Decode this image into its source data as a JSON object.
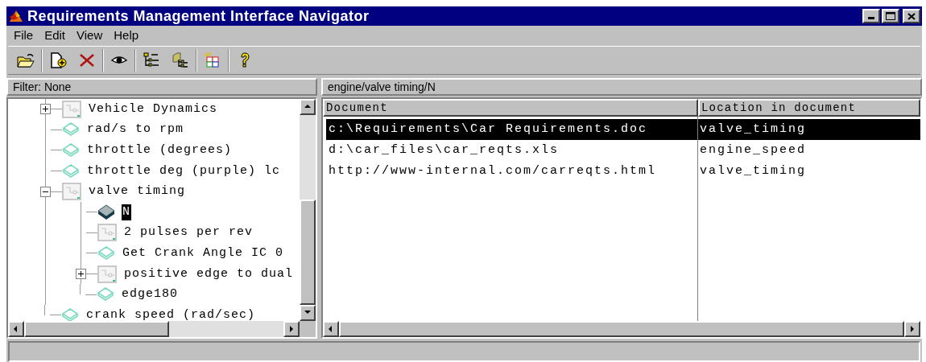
{
  "window": {
    "title": "Requirements Management Interface Navigator"
  },
  "menu": [
    "File",
    "Edit",
    "View",
    "Help"
  ],
  "filter": "Filter: None",
  "path": "engine/valve timing/N",
  "tree": [
    {
      "label": "Vehicle Dynamics",
      "kind": "subsystem",
      "selected": false,
      "expanded": false
    },
    {
      "label": "rad/s to rpm",
      "kind": "port",
      "selected": false
    },
    {
      "label": "throttle (degrees)",
      "kind": "port",
      "selected": false
    },
    {
      "label": "throttle deg (purple) lc",
      "kind": "port",
      "selected": false
    },
    {
      "label": "valve timing",
      "kind": "subsystem",
      "selected": false,
      "expanded": true,
      "children": [
        {
          "label": "N",
          "kind": "solid",
          "selected": true
        },
        {
          "label": "2 pulses per rev",
          "kind": "subsystem",
          "selected": false
        },
        {
          "label": "Get Crank Angle IC 0",
          "kind": "port",
          "selected": false
        },
        {
          "label": "positive edge to dual",
          "kind": "subsystem",
          "selected": false,
          "expanded": false
        },
        {
          "label": "edge180",
          "kind": "port",
          "selected": false
        }
      ]
    },
    {
      "label": "crank speed (rad/sec)",
      "kind": "port",
      "selected": false
    }
  ],
  "table": {
    "columns": [
      "Document",
      "Location in document"
    ],
    "rows": [
      {
        "cells": [
          "c:\\Requirements\\Car Requirements.doc",
          "valve_timing"
        ],
        "selected": true
      },
      {
        "cells": [
          "d:\\car_files\\car_reqts.xls",
          "engine_speed"
        ],
        "selected": false
      },
      {
        "cells": [
          "http://www-internal.com/carreqts.html",
          "valve_timing"
        ],
        "selected": false
      }
    ]
  }
}
